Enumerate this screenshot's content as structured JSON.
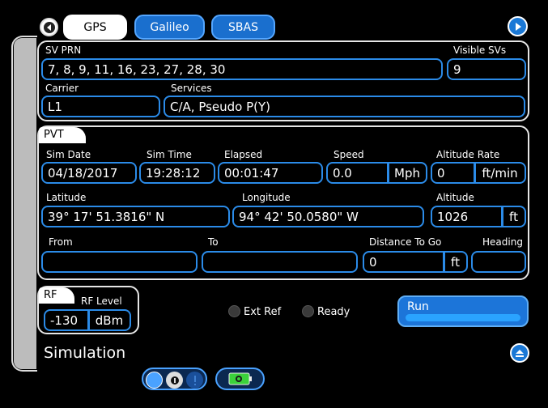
{
  "tabs": [
    {
      "label": "GPS",
      "active": true
    },
    {
      "label": "Galileo",
      "active": false
    },
    {
      "label": "SBAS",
      "active": false
    }
  ],
  "sv": {
    "prn_label": "SV PRN",
    "prn_value": "7, 8, 9, 11, 16, 23, 27, 28, 30",
    "visible_label": "Visible SVs",
    "visible_value": "9",
    "carrier_label": "Carrier",
    "carrier_value": "L1",
    "services_label": "Services",
    "services_value": "C/A, Pseudo P(Y)"
  },
  "pvt": {
    "tab_label": "PVT",
    "sim_date_label": "Sim Date",
    "sim_date_value": "04/18/2017",
    "sim_time_label": "Sim Time",
    "sim_time_value": "19:28:12",
    "elapsed_label": "Elapsed",
    "elapsed_value": "00:01:47",
    "speed_label": "Speed",
    "speed_value": "0.0",
    "speed_unit": "Mph",
    "alt_rate_label": "Altitude Rate",
    "alt_rate_value": "0",
    "alt_rate_unit": "ft/min",
    "latitude_label": "Latitude",
    "latitude_value": "39° 17' 51.3816\" N",
    "longitude_label": "Longitude",
    "longitude_value": "94° 42' 50.0580\" W",
    "altitude_label": "Altitude",
    "altitude_value": "1026",
    "altitude_unit": "ft",
    "from_label": "From",
    "from_value": "",
    "to_label": "To",
    "to_value": "",
    "dist_label": "Distance To Go",
    "dist_value": "0",
    "dist_unit": "ft",
    "heading_label": "Heading",
    "heading_value": ""
  },
  "rf": {
    "tab_label": "RF",
    "level_label": "RF Level",
    "level_value": "-130",
    "level_unit": "dBm"
  },
  "indicators": {
    "ext_ref": "Ext Ref",
    "ready": "Ready"
  },
  "run_label": "Run",
  "screen_title": "Simulation",
  "colors": {
    "accent": "#2b8be8",
    "tab_blue": "#1a6fce",
    "panel_border": "#e6e6e6",
    "side_bar": "#bcbcbc",
    "battery_green": "#3bd13b"
  }
}
